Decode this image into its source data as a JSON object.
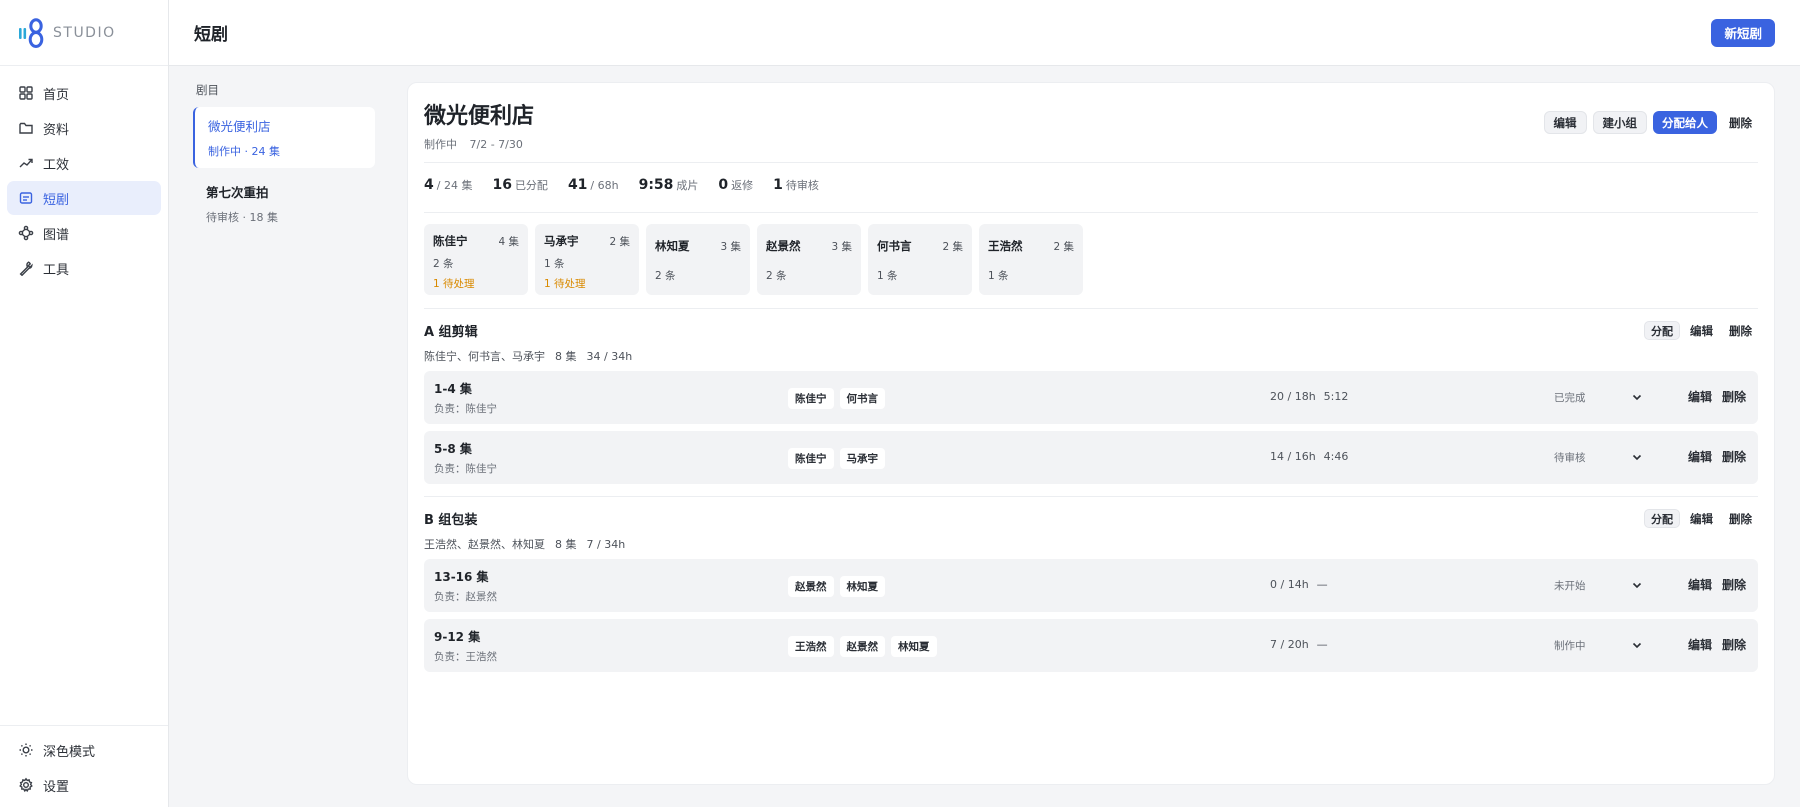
{
  "brand": {
    "name": "STUDIO",
    "logo_icon": "studio-logo-icon"
  },
  "nav": [
    {
      "key": "home",
      "label": "首页",
      "icon": "grid-icon"
    },
    {
      "key": "data",
      "label": "资料",
      "icon": "folder-icon"
    },
    {
      "key": "efficiency",
      "label": "工效",
      "icon": "trend-icon"
    },
    {
      "key": "drama",
      "label": "短剧",
      "icon": "drama-icon",
      "active": true
    },
    {
      "key": "graph",
      "label": "图谱",
      "icon": "graph-icon"
    },
    {
      "key": "tools",
      "label": "工具",
      "icon": "wrench-icon"
    }
  ],
  "sidebar_bottom": {
    "dark_mode": "深色模式",
    "settings": "设置"
  },
  "header": {
    "title": "短剧",
    "new_button": "新短剧"
  },
  "list": {
    "label": "剧目",
    "items": [
      {
        "name": "微光便利店",
        "meta": "制作中 · 24 集",
        "active": true
      },
      {
        "name": "第七次重拍",
        "meta": "待审核 · 18 集"
      }
    ]
  },
  "detail": {
    "title": "微光便利店",
    "status": "制作中",
    "date_range": "7/2 - 7/30",
    "actions": {
      "edit": "编辑",
      "subgroup": "建小组",
      "assign": "分配给人",
      "delete": "删除"
    },
    "stats": [
      {
        "value": "4",
        "label": "/ 24 集"
      },
      {
        "value": "16",
        "label": "已分配"
      },
      {
        "value": "41",
        "label": "/ 68h"
      },
      {
        "value": "9:58",
        "label": "成片"
      },
      {
        "value": "0",
        "label": "返修"
      },
      {
        "value": "1",
        "label": "待审核"
      }
    ],
    "members": [
      {
        "name": "陈佳宁",
        "episodes": "4 集",
        "count": "2 条",
        "pending": "1 待处理"
      },
      {
        "name": "马承宇",
        "episodes": "2 集",
        "count": "1 条",
        "pending": "1 待处理"
      },
      {
        "name": "林知夏",
        "episodes": "3 集",
        "count": "2 条"
      },
      {
        "name": "赵景然",
        "episodes": "3 集",
        "count": "2 条"
      },
      {
        "name": "何书言",
        "episodes": "2 集",
        "count": "1 条"
      },
      {
        "name": "王浩然",
        "episodes": "2 集",
        "count": "1 条"
      }
    ],
    "groups": [
      {
        "title": "A 组剪辑",
        "people": "陈佳宁、何书言、马承宇",
        "episodes": "8 集",
        "hours": "34 / 34h",
        "actions": {
          "assign": "分配",
          "edit": "编辑",
          "delete": "删除"
        },
        "rows": [
          {
            "name": "1-4 集",
            "owner": "负责：陈佳宁",
            "tags": [
              "陈佳宁",
              "何书言"
            ],
            "progress": "20 / 18h",
            "duration": "5:12",
            "status": "已完成",
            "edit": "编辑",
            "delete": "删除"
          },
          {
            "name": "5-8 集",
            "owner": "负责：陈佳宁",
            "tags": [
              "陈佳宁",
              "马承宇"
            ],
            "progress": "14 / 16h",
            "duration": "4:46",
            "status": "待审核",
            "edit": "编辑",
            "delete": "删除"
          }
        ]
      },
      {
        "title": "B 组包装",
        "people": "王浩然、赵景然、林知夏",
        "episodes": "8 集",
        "hours": "7 / 34h",
        "actions": {
          "assign": "分配",
          "edit": "编辑",
          "delete": "删除"
        },
        "rows": [
          {
            "name": "13-16 集",
            "owner": "负责：赵景然",
            "tags": [
              "赵景然",
              "林知夏"
            ],
            "progress": "0 / 14h",
            "duration": "—",
            "status": "未开始",
            "edit": "编辑",
            "delete": "删除"
          },
          {
            "name": "9-12 集",
            "owner": "负责：王浩然",
            "tags": [
              "王浩然",
              "赵景然",
              "林知夏"
            ],
            "progress": "7 / 20h",
            "duration": "—",
            "status": "制作中",
            "edit": "编辑",
            "delete": "删除"
          }
        ]
      }
    ]
  },
  "colors": {
    "accent": "#3a63e0",
    "pending": "#d98a00",
    "background": "#f4f5f7"
  }
}
